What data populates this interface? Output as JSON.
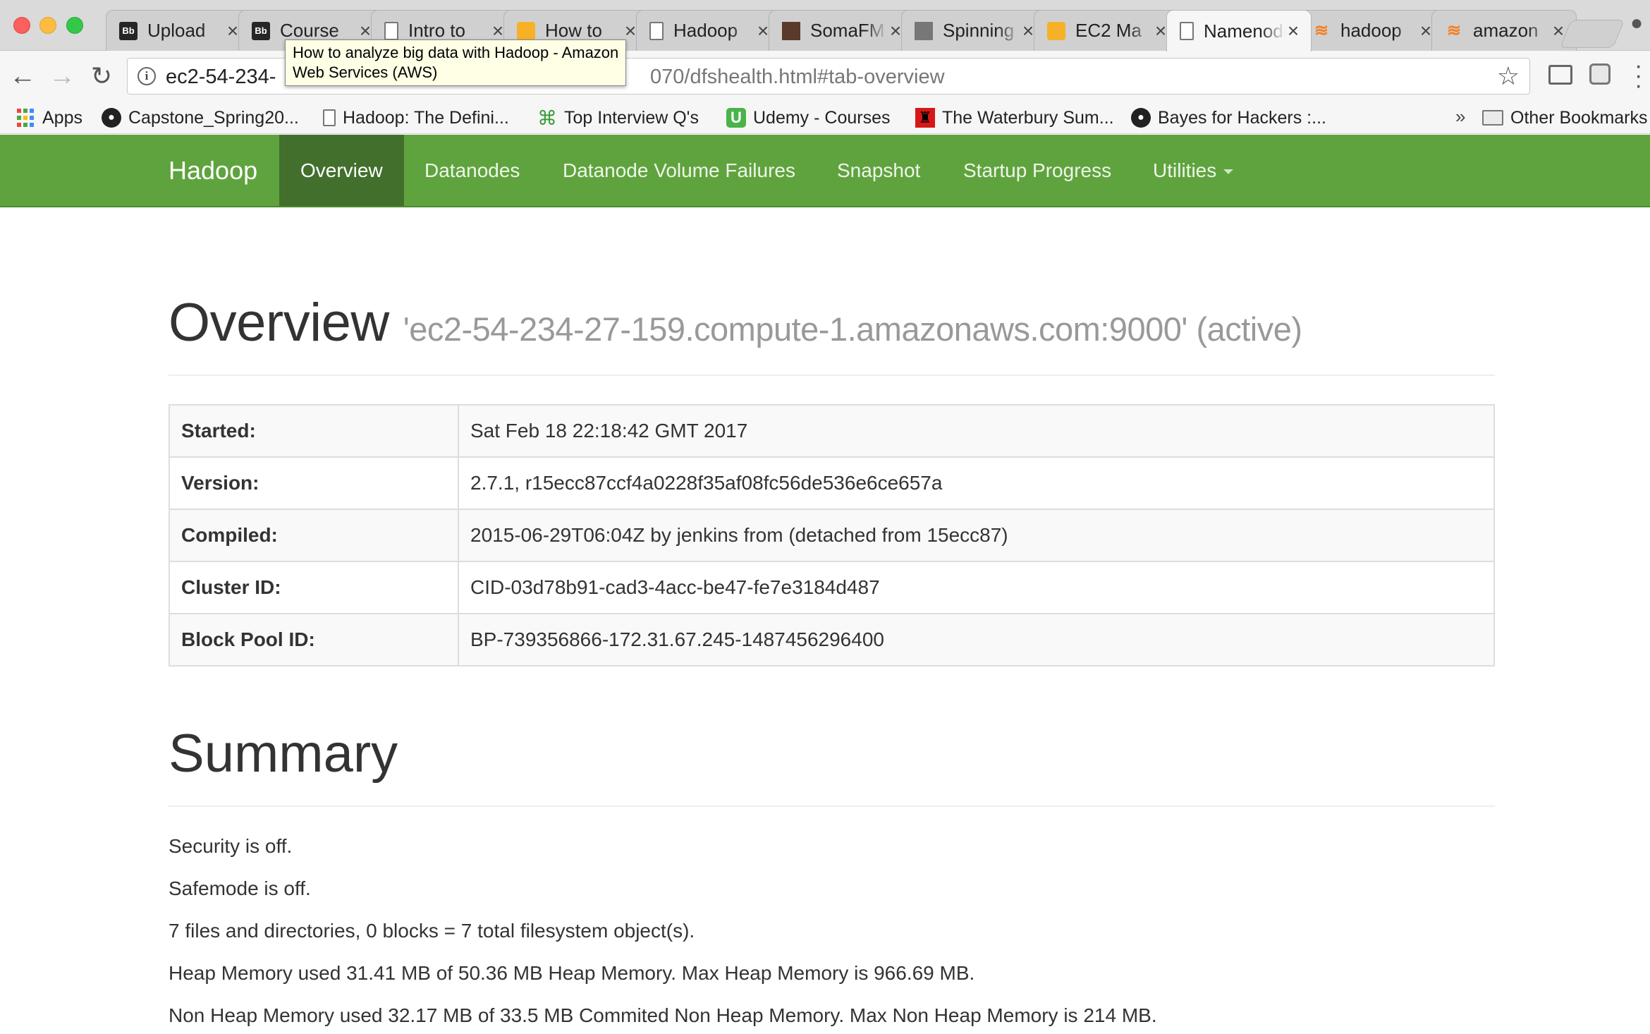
{
  "browser": {
    "tabs": [
      {
        "title": "Upload",
        "icon": "blackboard-icon"
      },
      {
        "title": "Course",
        "icon": "blackboard-icon"
      },
      {
        "title": "Intro to",
        "icon": "document-icon"
      },
      {
        "title": "How to",
        "icon": "aws-icon"
      },
      {
        "title": "Hadoop",
        "icon": "document-icon"
      },
      {
        "title": "SomaFM",
        "icon": "somafm-icon"
      },
      {
        "title": "Spinning",
        "icon": "spinning-icon"
      },
      {
        "title": "EC2 Ma",
        "icon": "aws-icon"
      },
      {
        "title": "Namenode",
        "icon": "document-icon",
        "active": true
      },
      {
        "title": "hadoop",
        "icon": "stackoverflow-icon"
      },
      {
        "title": "amazon",
        "icon": "stackoverflow-icon"
      }
    ],
    "tooltip": [
      "How to analyze big data with Hadoop - Amazon",
      "Web Services (AWS)"
    ],
    "url_visible_start": "ec2-54-234-",
    "url_visible_end": "070/dfshealth.html#tab-overview",
    "bookmarks": [
      {
        "label": "Apps",
        "icon": "apps-grid-icon"
      },
      {
        "label": "Capstone_Spring20...",
        "icon": "github-icon"
      },
      {
        "label": "Hadoop: The Defini...",
        "icon": "document-icon"
      },
      {
        "label": "Top Interview Q's",
        "icon": "clover-icon"
      },
      {
        "label": "Udemy - Courses",
        "icon": "udemy-icon"
      },
      {
        "label": "The Waterbury Sum...",
        "icon": "waterbury-icon"
      },
      {
        "label": "Bayes for Hackers :...",
        "icon": "github-icon"
      }
    ],
    "bookmarks_more": "»",
    "other_bookmarks": "Other Bookmarks"
  },
  "navbar": {
    "brand": "Hadoop",
    "items": [
      {
        "label": "Overview",
        "active": true
      },
      {
        "label": "Datanodes"
      },
      {
        "label": "Datanode Volume Failures"
      },
      {
        "label": "Snapshot"
      },
      {
        "label": "Startup Progress"
      },
      {
        "label": "Utilities",
        "dropdown": true
      }
    ],
    "color": "#5fa33e",
    "active_color": "#426f2c"
  },
  "overview": {
    "heading": "Overview",
    "subheading": "'ec2-54-234-27-159.compute-1.amazonaws.com:9000' (active)",
    "rows": [
      {
        "label": "Started:",
        "value": "Sat Feb 18 22:18:42 GMT 2017"
      },
      {
        "label": "Version:",
        "value": "2.7.1, r15ecc87ccf4a0228f35af08fc56de536e6ce657a"
      },
      {
        "label": "Compiled:",
        "value": "2015-06-29T06:04Z by jenkins from (detached from 15ecc87)"
      },
      {
        "label": "Cluster ID:",
        "value": "CID-03d78b91-cad3-4acc-be47-fe7e3184d487"
      },
      {
        "label": "Block Pool ID:",
        "value": "BP-739356866-172.31.67.245-1487456296400"
      }
    ]
  },
  "summary": {
    "heading": "Summary",
    "lines": [
      "Security is off.",
      "Safemode is off.",
      "7 files and directories, 0 blocks = 7 total filesystem object(s).",
      "Heap Memory used 31.41 MB of 50.36 MB Heap Memory. Max Heap Memory is 966.69 MB.",
      "Non Heap Memory used 32.17 MB of 33.5 MB Commited Non Heap Memory. Max Non Heap Memory is 214 MB."
    ]
  }
}
